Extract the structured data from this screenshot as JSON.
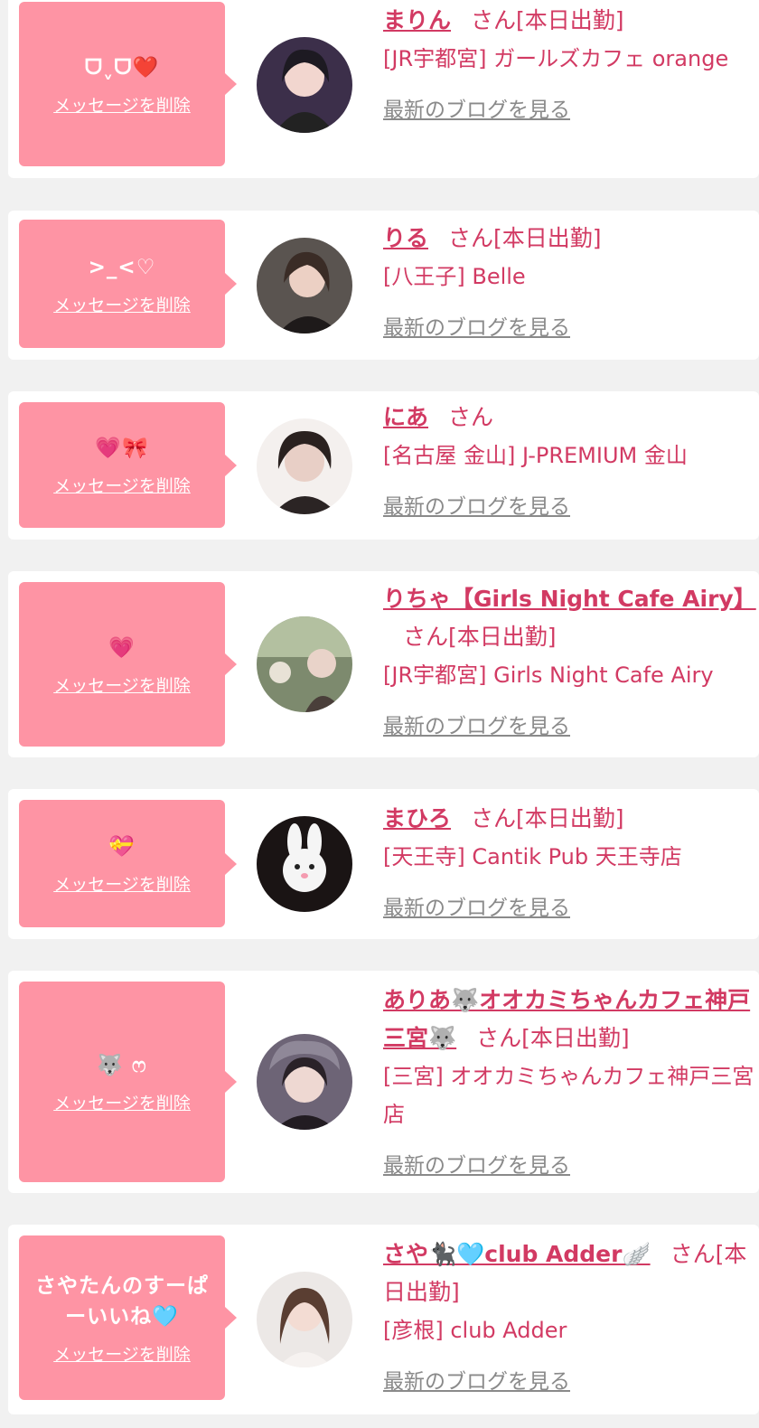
{
  "colors": {
    "background": "#f1f1f1",
    "card": "#ffffff",
    "bubble": "#fe94a4",
    "name": "#d23a63",
    "link_gray": "#8a8a8a"
  },
  "common": {
    "delete_label": "メッセージを削除",
    "blog_label": "最新のブログを見る"
  },
  "messages": [
    {
      "message": "ᗜˬᗜ❤️",
      "name": "まりん",
      "suffix": "さん[本日出勤]",
      "shop": "[JR宇都宮] ガールズカフェ orange",
      "avatar_icon": "profile-photo"
    },
    {
      "message": ">_<♡",
      "name": "りる",
      "suffix": "さん[本日出勤]",
      "shop": "[八王子] Belle",
      "avatar_icon": "profile-photo"
    },
    {
      "message": "💗🎀",
      "name": "にあ",
      "suffix": "さん",
      "shop": "[名古屋 金山] J-PREMIUM 金山",
      "avatar_icon": "profile-photo"
    },
    {
      "message": "💗",
      "name": "りちゃ【Girls Night Cafe Airy】",
      "suffix": "さん[本日出勤]",
      "shop": "[JR宇都宮] Girls Night Cafe Airy",
      "avatar_icon": "profile-photo"
    },
    {
      "message": "💝",
      "name": "まひろ",
      "suffix": "さん[本日出勤]",
      "shop": "[天王寺] Cantik Pub 天王寺店",
      "avatar_icon": "profile-photo"
    },
    {
      "message": "🐺 ෆ",
      "name": "ありあ🐺オオカミちゃんカフェ神戸三宮🐺",
      "suffix": "さん[本日出勤]",
      "shop": "[三宮] オオカミちゃんカフェ神戸三宮店",
      "avatar_icon": "profile-photo"
    },
    {
      "message": "さやたんのすーぱーいいね🩵",
      "name": "さや🐈‍⬛🩵club Adder🪽",
      "suffix": "さん[本日出勤]",
      "shop": "[彦根] club Adder",
      "avatar_icon": "profile-photo"
    }
  ]
}
